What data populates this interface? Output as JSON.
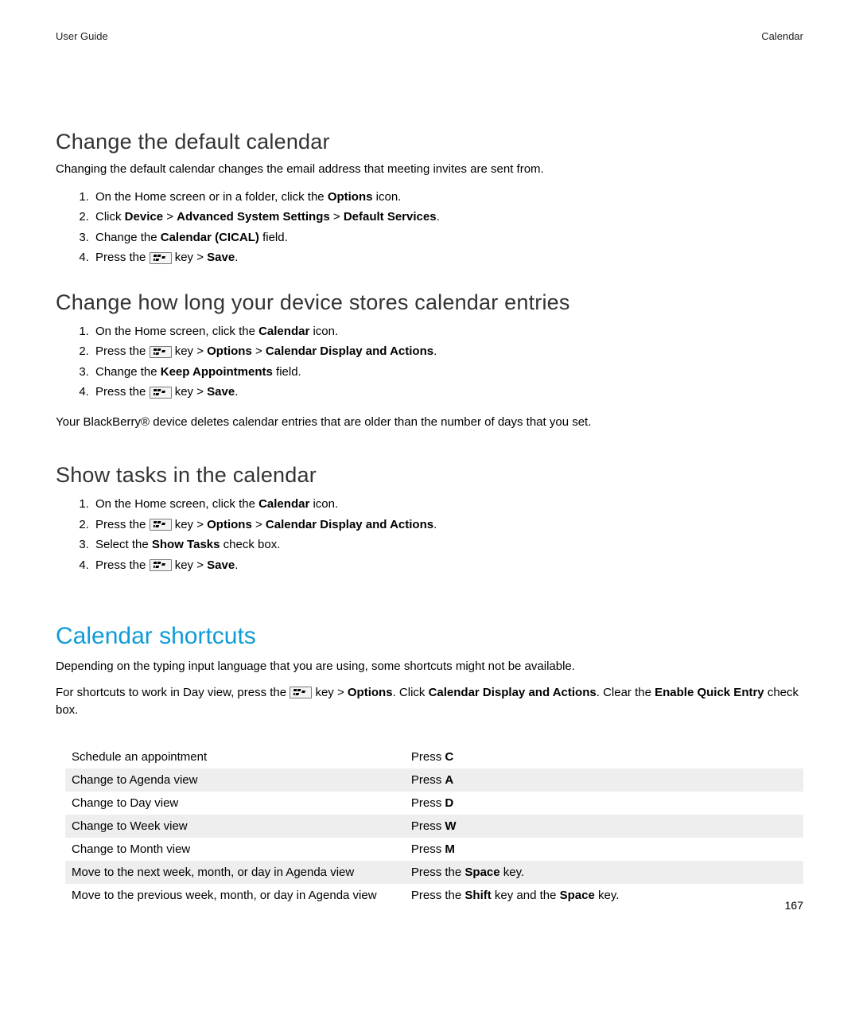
{
  "header": {
    "left": "User Guide",
    "right": "Calendar"
  },
  "page_number": "167",
  "sections": {
    "s1": {
      "title": "Change the default calendar",
      "intro": "Changing the default calendar changes the email address that meeting invites are sent from.",
      "step1_a": "On the Home screen or in a folder, click the ",
      "step1_b": "Options",
      "step1_c": " icon.",
      "step2_a": "Click ",
      "step2_b": "Device",
      "step2_c": " > ",
      "step2_d": "Advanced System Settings",
      "step2_e": " > ",
      "step2_f": "Default Services",
      "step2_g": ".",
      "step3_a": "Change the ",
      "step3_b": "Calendar (CICAL)",
      "step3_c": " field.",
      "step4_a": "Press the ",
      "step4_b": " key > ",
      "step4_c": "Save",
      "step4_d": "."
    },
    "s2": {
      "title": "Change how long your device stores calendar entries",
      "step1_a": "On the Home screen, click the ",
      "step1_b": "Calendar",
      "step1_c": " icon.",
      "step2_a": "Press the ",
      "step2_b": " key > ",
      "step2_c": "Options",
      "step2_d": " > ",
      "step2_e": "Calendar Display and Actions",
      "step2_f": ".",
      "step3_a": "Change the ",
      "step3_b": "Keep Appointments",
      "step3_c": " field.",
      "step4_a": "Press the ",
      "step4_b": " key > ",
      "step4_c": "Save",
      "step4_d": ".",
      "note": "Your BlackBerry® device deletes calendar entries that are older than the number of days that you set."
    },
    "s3": {
      "title": "Show tasks in the calendar",
      "step1_a": "On the Home screen, click the ",
      "step1_b": "Calendar",
      "step1_c": " icon.",
      "step2_a": "Press the ",
      "step2_b": " key > ",
      "step2_c": "Options",
      "step2_d": " > ",
      "step2_e": "Calendar Display and Actions",
      "step2_f": ".",
      "step3_a": "Select the ",
      "step3_b": "Show Tasks",
      "step3_c": " check box.",
      "step4_a": "Press the ",
      "step4_b": " key > ",
      "step4_c": "Save",
      "step4_d": "."
    },
    "s4": {
      "title": "Calendar shortcuts",
      "intro1": "Depending on the typing input language that you are using, some shortcuts might not be available.",
      "intro2_a": "For shortcuts to work in Day view, press the ",
      "intro2_b": " key > ",
      "intro2_c": "Options",
      "intro2_d": ". Click ",
      "intro2_e": "Calendar Display and Actions",
      "intro2_f": ". Clear the ",
      "intro2_g": "Enable Quick Entry",
      "intro2_h": " check box."
    }
  },
  "shortcuts": [
    {
      "action": "Schedule an appointment",
      "key_pre": "Press ",
      "key_bold": "C",
      "key_post": ""
    },
    {
      "action": "Change to Agenda view",
      "key_pre": "Press ",
      "key_bold": "A",
      "key_post": ""
    },
    {
      "action": "Change to Day view",
      "key_pre": "Press ",
      "key_bold": "D",
      "key_post": ""
    },
    {
      "action": "Change to Week view",
      "key_pre": "Press ",
      "key_bold": "W",
      "key_post": ""
    },
    {
      "action": "Change to Month view",
      "key_pre": "Press ",
      "key_bold": "M",
      "key_post": ""
    },
    {
      "action": "Move to the next week, month, or day in Agenda view",
      "key_pre": "Press the ",
      "key_bold": "Space",
      "key_post": " key."
    },
    {
      "action": "Move to the previous week, month, or day in Agenda view",
      "key_pre": "Press the ",
      "key_bold": "Shift",
      "key_mid": " key and the ",
      "key_bold2": "Space",
      "key_post": " key."
    }
  ]
}
